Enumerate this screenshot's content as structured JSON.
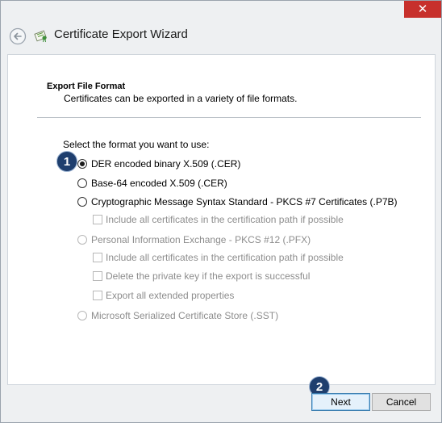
{
  "window": {
    "close_glyph": "✕",
    "title": "Certificate Export Wizard"
  },
  "page": {
    "heading": "Export File Format",
    "description": "Certificates can be exported in a variety of file formats.",
    "prompt": "Select the format you want to use:"
  },
  "options": {
    "der": {
      "label": "DER encoded binary X.509 (.CER)",
      "selected": true,
      "enabled": true
    },
    "base64": {
      "label": "Base-64 encoded X.509 (.CER)",
      "selected": false,
      "enabled": true
    },
    "pkcs7": {
      "label": "Cryptographic Message Syntax Standard - PKCS #7 Certificates (.P7B)",
      "selected": false,
      "enabled": true
    },
    "pkcs7_include_all": {
      "label": "Include all certificates in the certification path if possible",
      "checked": false,
      "enabled": false
    },
    "pfx": {
      "label": "Personal Information Exchange - PKCS #12 (.PFX)",
      "selected": false,
      "enabled": false
    },
    "pfx_include_all": {
      "label": "Include all certificates in the certification path if possible",
      "checked": false,
      "enabled": false
    },
    "pfx_delete_key": {
      "label": "Delete the private key if the export is successful",
      "checked": false,
      "enabled": false
    },
    "pfx_export_ext": {
      "label": "Export all extended properties",
      "checked": false,
      "enabled": false
    },
    "sst": {
      "label": "Microsoft Serialized Certificate Store (.SST)",
      "selected": false,
      "enabled": false
    }
  },
  "annotations": {
    "step1": "1",
    "step2": "2"
  },
  "buttons": {
    "next": "Next",
    "cancel": "Cancel"
  },
  "colors": {
    "close_red": "#c7302c",
    "badge_navy": "#1f3f6e",
    "default_button_border": "#3c7fb1"
  }
}
